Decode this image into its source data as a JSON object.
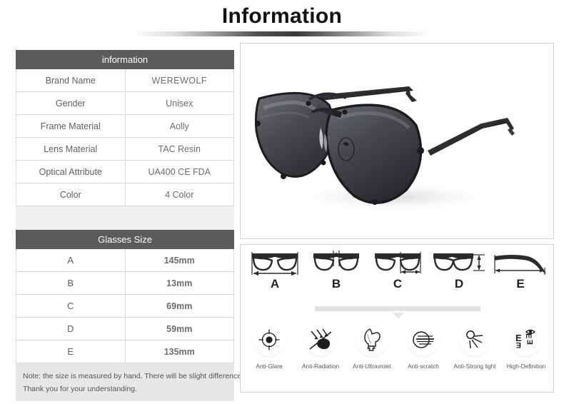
{
  "header": {
    "title": "Information"
  },
  "info_table": {
    "header": "information",
    "rows": [
      {
        "key": "Brand Name",
        "value": "WEREWOLF",
        "style": "big"
      },
      {
        "key": "Gender",
        "value": "Unisex",
        "style": "small"
      },
      {
        "key": "Frame Material",
        "value": "Aolly",
        "style": "mid"
      },
      {
        "key": "Lens Material",
        "value": "TAC Resin",
        "style": "small"
      },
      {
        "key": "Optical Attribute",
        "value": "UA400 CE FDA",
        "style": "small"
      },
      {
        "key": "Color",
        "value": "4 Color",
        "style": "mid"
      }
    ]
  },
  "size_table": {
    "header": "Glasses Size",
    "rows": [
      {
        "key": "A",
        "value": "145mm"
      },
      {
        "key": "B",
        "value": "13mm"
      },
      {
        "key": "C",
        "value": "69mm"
      },
      {
        "key": "D",
        "value": "59mm"
      },
      {
        "key": "E",
        "value": "135mm"
      }
    ]
  },
  "note": {
    "line1": "Note: the size is measured by hand. There will be slight difference.",
    "line2": "Thank you for your understanding."
  },
  "product_photo": {
    "alt": "black aviator sunglasses"
  },
  "diagrams": [
    {
      "label": "A",
      "icon": "glasses-front-width-icon"
    },
    {
      "label": "B",
      "icon": "glasses-bridge-width-icon"
    },
    {
      "label": "C",
      "icon": "glasses-lens-width-icon"
    },
    {
      "label": "D",
      "icon": "glasses-lens-height-icon"
    },
    {
      "label": "E",
      "icon": "glasses-temple-length-icon"
    }
  ],
  "features": [
    {
      "label": "Anti-Glare",
      "icon": "target-crosshair-icon"
    },
    {
      "label": "Anti-Radiation",
      "icon": "radiation-arrows-icon"
    },
    {
      "label": "Anti-Ultraviolet",
      "icon": "bird-icon"
    },
    {
      "label": "Anti-scratch",
      "icon": "scratch-circle-icon"
    },
    {
      "label": "Anti-Strong light",
      "icon": "sun-rays-icon"
    },
    {
      "label": "High-Definition",
      "icon": "eye-chart-icon"
    }
  ],
  "colors": {
    "header_bar": "#5b5b5b",
    "panel_border": "#d5d5d5",
    "note_bg": "#e7e7e7",
    "gap_bg": "#efefef"
  }
}
